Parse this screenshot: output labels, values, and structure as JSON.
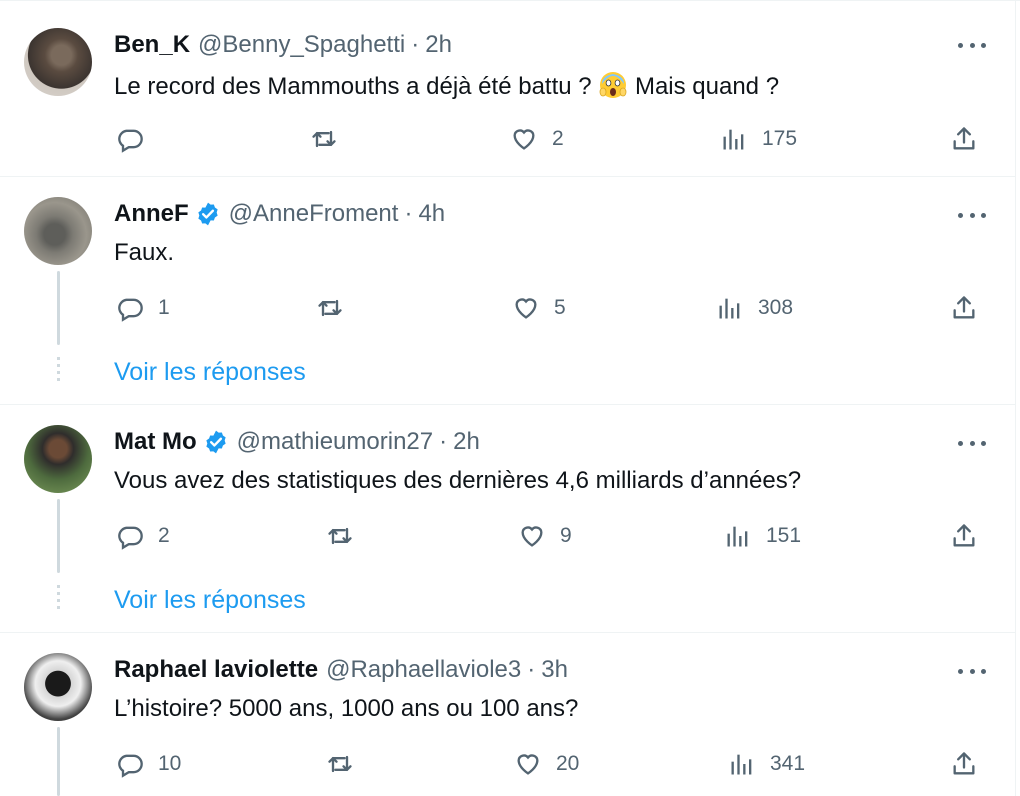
{
  "replies": [
    {
      "name": "Ben_K",
      "verified": false,
      "handle": "@Benny_Spaghetti",
      "separator": "·",
      "time": "2h",
      "text_before": "Le record des Mammouths a déjà été battu ? ",
      "emoji": "😱",
      "text_after": " Mais quand ?",
      "replies_count": "",
      "likes": "2",
      "views": "175",
      "show_replies": ""
    },
    {
      "name": "AnneF",
      "verified": true,
      "handle": "@AnneFroment",
      "separator": "·",
      "time": "4h",
      "text": "Faux.",
      "replies_count": "1",
      "likes": "5",
      "views": "308",
      "show_replies": "Voir les réponses"
    },
    {
      "name": "Mat Mo",
      "verified": true,
      "handle": "@mathieumorin27",
      "separator": "·",
      "time": "2h",
      "text": "Vous avez des statistiques des dernières 4,6 milliards d’années?",
      "replies_count": "2",
      "likes": "9",
      "views": "151",
      "show_replies": "Voir les réponses"
    },
    {
      "name": "Raphael laviolette",
      "verified": false,
      "handle": "@Raphaellaviole3",
      "separator": "·",
      "time": "3h",
      "text": "L’histoire? 5000 ans, 1000 ans ou 100 ans?",
      "replies_count": "10",
      "likes": "20",
      "views": "341",
      "show_replies": ""
    }
  ],
  "icons": {
    "reply": "speech-bubble-icon",
    "retweet": "retweet-icon",
    "like": "heart-icon",
    "views": "bar-chart-icon",
    "share": "share-upload-icon",
    "more": "more-dots-icon",
    "verified": "verified-badge-icon"
  },
  "colors": {
    "text": "#0f1419",
    "secondary": "#536471",
    "link": "#1d9bf0",
    "verified": "#1d9bf0",
    "border": "#eff3f4"
  }
}
